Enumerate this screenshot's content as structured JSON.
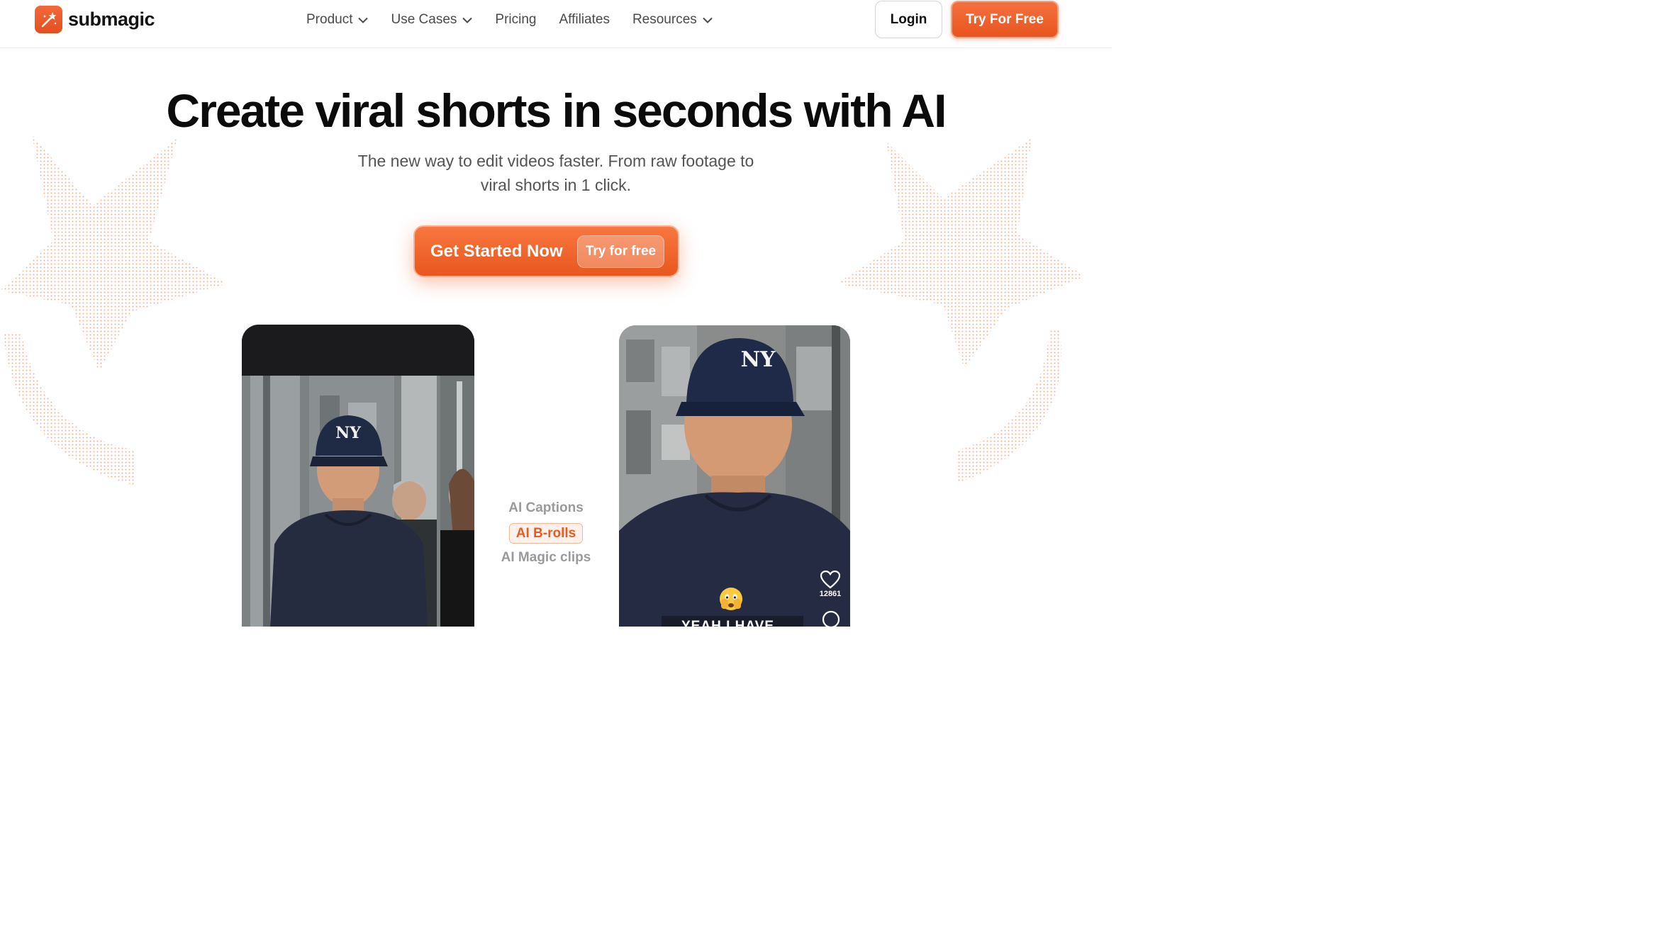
{
  "nav": {
    "brand": "submagic",
    "links": [
      {
        "label": "Product",
        "has_dropdown": true
      },
      {
        "label": "Use Cases",
        "has_dropdown": true
      },
      {
        "label": "Pricing",
        "has_dropdown": false
      },
      {
        "label": "Affiliates",
        "has_dropdown": false
      },
      {
        "label": "Resources",
        "has_dropdown": true
      }
    ],
    "login_label": "Login",
    "try_label": "Try For Free"
  },
  "hero": {
    "title": "Create viral shorts in seconds with AI",
    "subtitle_line1": "The new way to edit videos faster. From raw footage to",
    "subtitle_line2": "viral shorts in 1 click.",
    "cta_label": "Get Started Now",
    "cta_pill": "Try for free"
  },
  "features": {
    "items": [
      "AI Captions",
      "AI B-rolls",
      "AI Magic clips"
    ],
    "active": "AI B-rolls"
  },
  "video_right": {
    "like_count": "12861",
    "caption_partial": "YEAH I HAVE"
  },
  "colors": {
    "accent": "#e9571e",
    "accent_light": "#f7773f",
    "text_dark": "#0b0b0b",
    "text_muted": "#545454"
  },
  "icons": [
    "logo-wand-icon",
    "chevron-down-icon",
    "heart-icon",
    "comment-icon",
    "nervous-emoji-icon"
  ]
}
